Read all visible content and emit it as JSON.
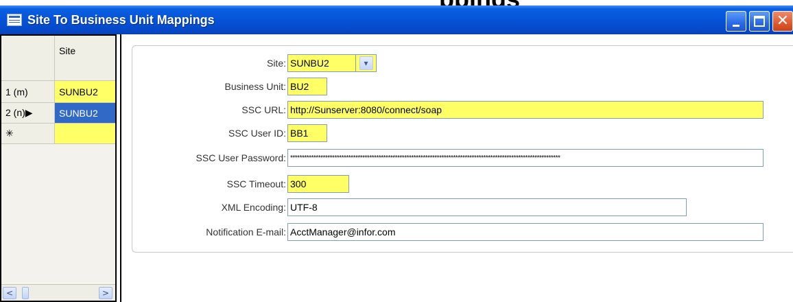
{
  "background_title": "ppings",
  "window": {
    "title": "Site To Business Unit Mappings",
    "icon": "form-window-icon",
    "buttons": {
      "minimize": "minimize-icon",
      "maximize": "maximize-icon",
      "close": "✕"
    }
  },
  "grid": {
    "column_header": "Site",
    "rows": [
      {
        "row_header": "1 (m)",
        "site": "SUNBU2"
      },
      {
        "row_header": "2 (n)▶",
        "site": "SUNBU2"
      },
      {
        "row_header": "✳",
        "site": ""
      }
    ],
    "scroll_left": "<",
    "scroll_right": ">"
  },
  "form": {
    "site": {
      "label": "Site:",
      "value": "SUNBU2",
      "dropdown_glyph": "▾"
    },
    "business_unit": {
      "label": "Business Unit:",
      "value": "BU2"
    },
    "ssc_url": {
      "label": "SSC URL:",
      "value": "http://Sunserver:8080/connect/soap"
    },
    "ssc_user_id": {
      "label": "SSC User ID:",
      "value": "BB1"
    },
    "ssc_user_password": {
      "label": "SSC User Password:",
      "value": "********************************************************************************************************************"
    },
    "ssc_timeout": {
      "label": "SSC Timeout:",
      "value": "300"
    },
    "xml_encoding": {
      "label": "XML Encoding:",
      "value": "UTF-8"
    },
    "notification_email": {
      "label": "Notification E-mail:",
      "value": "AcctManager@infor.com"
    }
  },
  "colors": {
    "required_field": "#ffff66",
    "selection": "#3169c6",
    "titlebar": "#0553d8"
  }
}
